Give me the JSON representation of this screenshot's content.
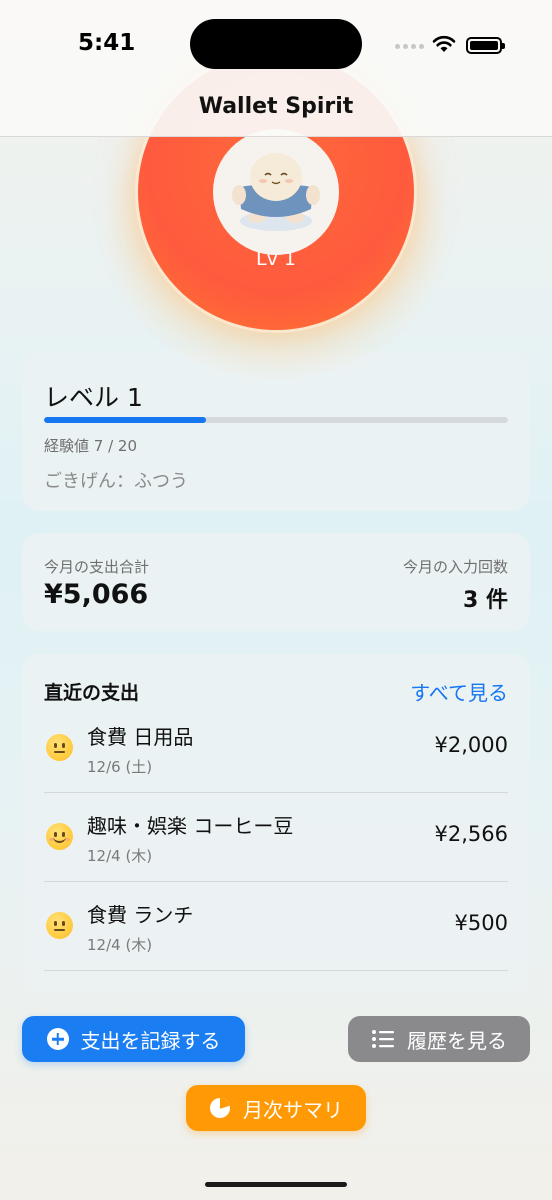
{
  "status_bar": {
    "time": "5:41"
  },
  "nav": {
    "title": "Wallet Spirit"
  },
  "spirit": {
    "level_badge": "Lv 1",
    "avatar_icon": "spirit-character-icon"
  },
  "level_card": {
    "title": "レベル 1",
    "xp_label": "経験値 7 / 20",
    "xp_fraction": 0.35,
    "mood": "ごきげん：ふつう"
  },
  "spend_card": {
    "total_label": "今月の支出合計",
    "total_value": "¥5,066",
    "count_label": "今月の入力回数",
    "count_value": "3 件"
  },
  "recent": {
    "title": "直近の支出",
    "see_all": "すべて見る",
    "items": [
      {
        "mood_icon": "neutral-face-icon",
        "title": "食費 日用品",
        "date": "12/6 (土)",
        "amount": "¥2,000"
      },
      {
        "mood_icon": "smiling-face-icon",
        "title": "趣味・娯楽 コーヒー豆",
        "date": "12/4 (木)",
        "amount": "¥2,566"
      },
      {
        "mood_icon": "neutral-face-icon",
        "title": "食費 ランチ",
        "date": "12/4 (木)",
        "amount": "¥500"
      }
    ]
  },
  "actions": {
    "record_label": "支出を記録する",
    "history_label": "履歴を見る",
    "summary_label": "月次サマリ"
  },
  "colors": {
    "accent_blue": "#1a7ef2",
    "orange": "#ff9a06",
    "spirit_red": "#ff5a3e",
    "gray_button": "#8a8a8c"
  }
}
